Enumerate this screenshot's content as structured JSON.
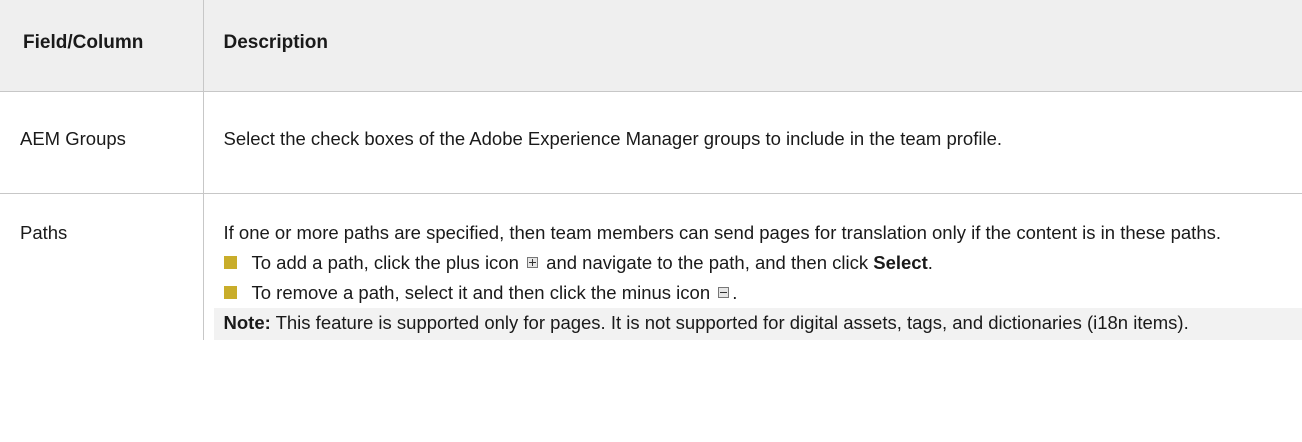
{
  "headers": {
    "col1": "Field/Column",
    "col2": "Description"
  },
  "rows": [
    {
      "field": "AEM Groups",
      "description": "Select the check boxes of the Adobe Experience Manager groups to include in the team profile."
    },
    {
      "field": "Paths",
      "intro": "If one or more paths are specified, then team members can send pages for translation only if the content is in these paths.",
      "bullets": [
        {
          "before": "To add a path, click the plus icon",
          "after": "and navigate to the path, and then click",
          "bold": "Select",
          "end": "."
        },
        {
          "before": "To remove a path, select it and then click the minus icon",
          "end": "."
        }
      ],
      "note": {
        "label": "Note:",
        "text": "This feature is supported only for pages. It is not supported for digital assets, tags, and dictionaries (i18n items)."
      }
    }
  ],
  "colors": {
    "header_bg": "#efefef",
    "bullet": "#c9ad2a",
    "note_bg": "#f2f2f2",
    "border": "#c7c7c7"
  }
}
